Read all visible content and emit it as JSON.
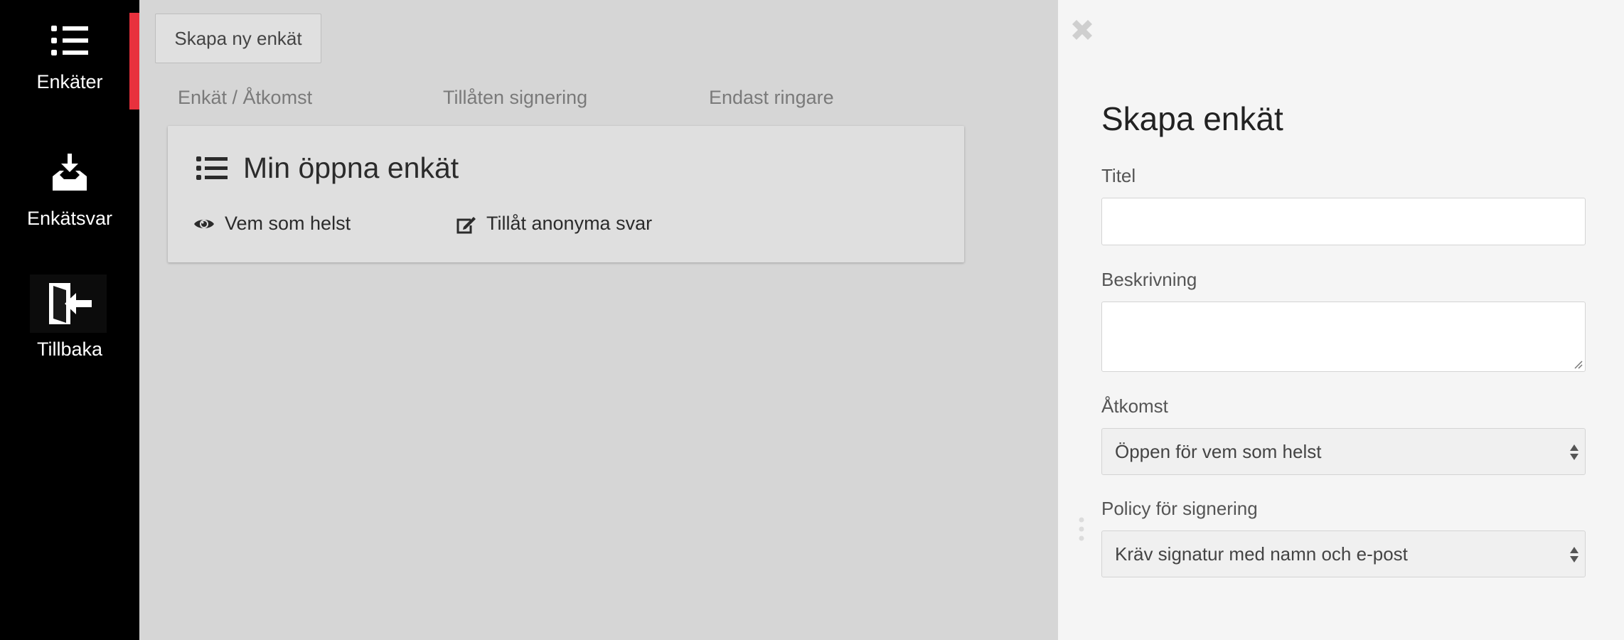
{
  "sidebar": {
    "items": [
      {
        "label": "Enkäter",
        "icon": "list-icon",
        "active": true
      },
      {
        "label": "Enkätsvar",
        "icon": "inbox-download-icon",
        "active": false
      },
      {
        "label": "Tillbaka",
        "icon": "sign-out-icon",
        "active": false
      }
    ],
    "active_color": "#e8313d"
  },
  "main": {
    "create_button": "Skapa ny enkät",
    "columns": [
      "Enkät / Åtkomst",
      "Tillåten signering",
      "Endast ringare"
    ],
    "surveys": [
      {
        "title": "Min öppna enkät",
        "access": "Vem som helst",
        "signing": "Tillåt anonyma svar"
      }
    ]
  },
  "panel": {
    "title": "Skapa enkät",
    "fields": {
      "title_label": "Titel",
      "title_value": "",
      "description_label": "Beskrivning",
      "description_value": "",
      "access_label": "Åtkomst",
      "access_value": "Öppen för vem som helst",
      "signing_label": "Policy för signering",
      "signing_value": "Kräv signatur med namn och e-post"
    }
  }
}
